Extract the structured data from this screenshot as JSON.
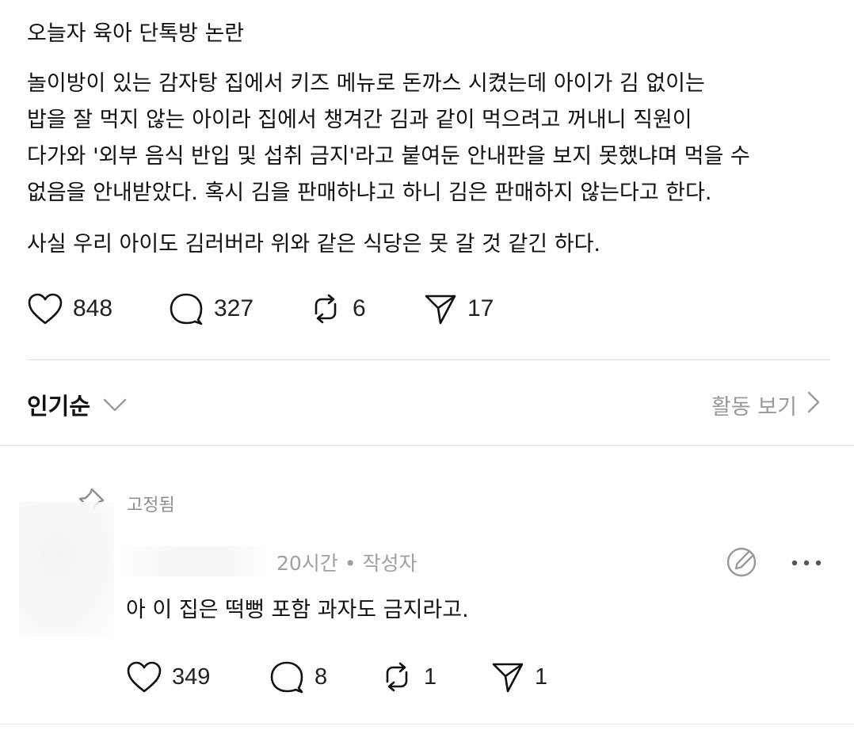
{
  "post": {
    "title": "오늘자 육아 단톡방 논란",
    "paragraph_1": "놀이방이 있는 감자탕 집에서 키즈 메뉴로 돈까스 시켰는데 아이가 김 없이는\n밥을 잘 먹지 않는 아이라 집에서 챙겨간 김과 같이 먹으려고 꺼내니 직원이\n다가와 '외부 음식 반입 및 섭취 금지'라고 붙여둔 안내판을 보지 못했냐며 먹을 수\n없음을 안내받았다. 혹시 김을 판매하냐고 하니 김은 판매하지 않는다고 한다.",
    "paragraph_2": "사실 우리 아이도 김러버라 위와 같은 식당은 못 갈 것 같긴 하다.",
    "likes": "848",
    "replies": "327",
    "reposts": "6",
    "shares": "17"
  },
  "sort": {
    "label": "인기순",
    "activity_link": "활동 보기"
  },
  "comment": {
    "pinned_label": "고정됨",
    "meta": "20시간 • 작성자",
    "text": "아 이 집은 떡뻥 포함 과자도 금지라고.",
    "likes": "349",
    "replies": "8",
    "reposts": "1",
    "shares": "1"
  },
  "icons": {
    "like": "heart-icon",
    "reply": "speech-bubble-icon",
    "repost": "repost-icon",
    "share": "send-icon",
    "sort": "chevron-down-icon",
    "activity": "chevron-right-icon",
    "pin": "pin-icon",
    "edit": "edit-circle-icon",
    "more": "more-dots-icon"
  },
  "colors": {
    "text": "#111111",
    "muted": "#999999",
    "divider": "#dedede"
  }
}
